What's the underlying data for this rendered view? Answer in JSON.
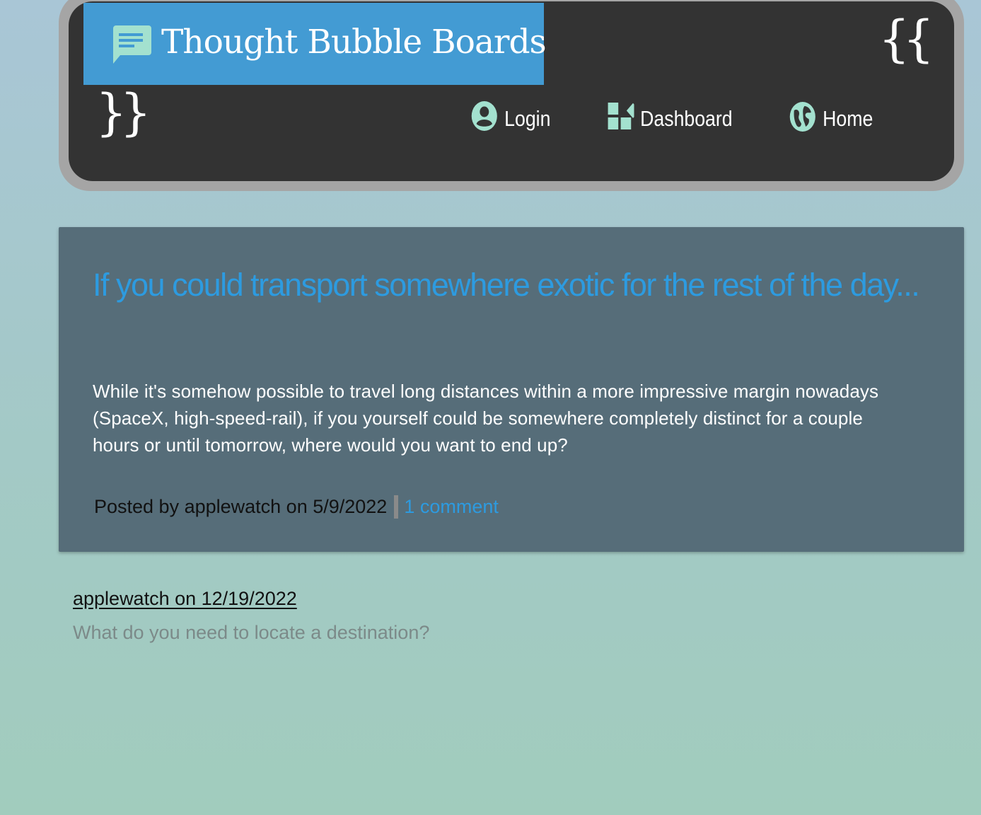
{
  "header": {
    "brand_title": "Thought Bubble Boards",
    "brace_open": "{{",
    "brace_close": "}}",
    "brand_color": "#439bd3",
    "icon_color": "#a3e1cf"
  },
  "nav": {
    "items": [
      {
        "label": "Login",
        "icon": "user-circle-icon"
      },
      {
        "label": "Dashboard",
        "icon": "widgets-icon"
      },
      {
        "label": "Home",
        "icon": "globe-icon"
      }
    ]
  },
  "post": {
    "title": "If you could transport somewhere exotic for the rest of the day...",
    "body": "While it's somehow possible to travel long distances within a more impressive margin nowadays (SpaceX, high-speed-rail), if you yourself could be somewhere completely distinct for a couple hours or until tomorrow, where would you want to end up?",
    "meta_text": "Posted by applewatch on 5/9/2022",
    "comment_link": "1 comment",
    "title_color": "#2d9be0"
  },
  "comments": [
    {
      "author_line": "applewatch on 12/19/2022",
      "text": "What do you need to locate a destination?"
    }
  ]
}
